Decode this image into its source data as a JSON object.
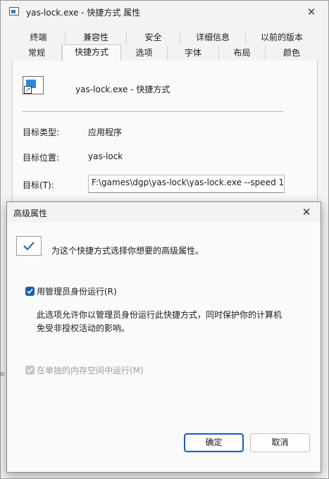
{
  "window": {
    "title": "yas-lock.exe - 快捷方式 属性",
    "close_glyph": "✕"
  },
  "tabs": {
    "top_row": [
      "终端",
      "兼容性",
      "安全",
      "详细信息",
      "以前的版本"
    ],
    "bottom_row": [
      "常规",
      "快捷方式",
      "选项",
      "字体",
      "布局",
      "颜色"
    ],
    "active": "快捷方式"
  },
  "shortcut": {
    "name": "yas-lock.exe - 快捷方式",
    "target_type_label": "目标类型:",
    "target_type_value": "应用程序",
    "target_location_label": "目标位置:",
    "target_location_value": "yas-lock",
    "target_label": "目标(T):",
    "target_value": "F:\\games\\dgp\\yas-lock\\yas-lock.exe --speed 1"
  },
  "dialog": {
    "title": "高级属性",
    "close_glyph": "✕",
    "intro": "为这个快捷方式选择你想要的高级属性。",
    "run_as_admin_label": "用管理员身份运行(R)",
    "run_as_admin_checked": true,
    "description_line1": "此选项允许你以管理员身份运行此快捷方式，同时保护你的计算机",
    "description_line2": "免受非授权活动的影响。",
    "separate_memory_label": "在单独的内存空间中运行(M)",
    "separate_memory_checked": true,
    "separate_memory_disabled": true,
    "ok_label": "确定",
    "cancel_label": "取消"
  },
  "background": {
    "edge_glyph": "e"
  },
  "colors": {
    "accent": "#1c5fb0",
    "window_bg": "#f3f3f3",
    "panel_bg": "#fafafa"
  }
}
